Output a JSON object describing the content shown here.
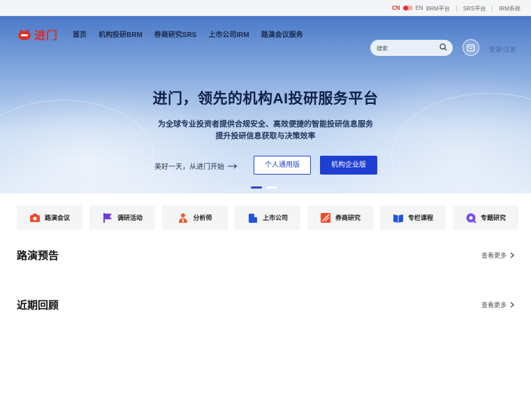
{
  "topbar": {
    "lang_cn": "CN",
    "lang_en": "EN",
    "links": [
      "BRM平台",
      "SRS平台",
      "IRM系统"
    ]
  },
  "nav": {
    "logo_text": "进门",
    "menu": [
      "首页",
      "机构投研BRM",
      "券商研究SRS",
      "上市公司IRM",
      "路演会议服务"
    ],
    "search_placeholder": "搜索",
    "login_label": "登录/注册"
  },
  "hero": {
    "title": "进门，领先的机构AI投研服务平台",
    "subtitle_line1": "为全球专业投资者提供合规安全、高效便捷的智能投研信息服务",
    "subtitle_line2": "提升投研信息获取与决策效率",
    "cta_text": "美好一天，从进门开始",
    "btn_personal": "个人通用版",
    "btn_enterprise": "机构企业版"
  },
  "categories": [
    {
      "label": "路演会议",
      "icon": "camera-icon",
      "color": "#f04a2c"
    },
    {
      "label": "调研活动",
      "icon": "flag-icon",
      "color": "#6a3de0"
    },
    {
      "label": "分析师",
      "icon": "person-icon",
      "color": "#f05a28"
    },
    {
      "label": "上市公司",
      "icon": "building-icon",
      "color": "#1f55e0"
    },
    {
      "label": "券商研究",
      "icon": "report-icon",
      "color": "#f04a2c"
    },
    {
      "label": "专栏课程",
      "icon": "book-icon",
      "color": "#1f55e0"
    },
    {
      "label": "专题研究",
      "icon": "topic-icon",
      "color": "#7a4de6"
    }
  ],
  "sections": {
    "upcoming_title": "路演预告",
    "recent_title": "近期回顾",
    "more_label": "查看更多"
  },
  "colors": {
    "brand_red": "#d9302a",
    "primary_blue": "#1f3fd3"
  }
}
